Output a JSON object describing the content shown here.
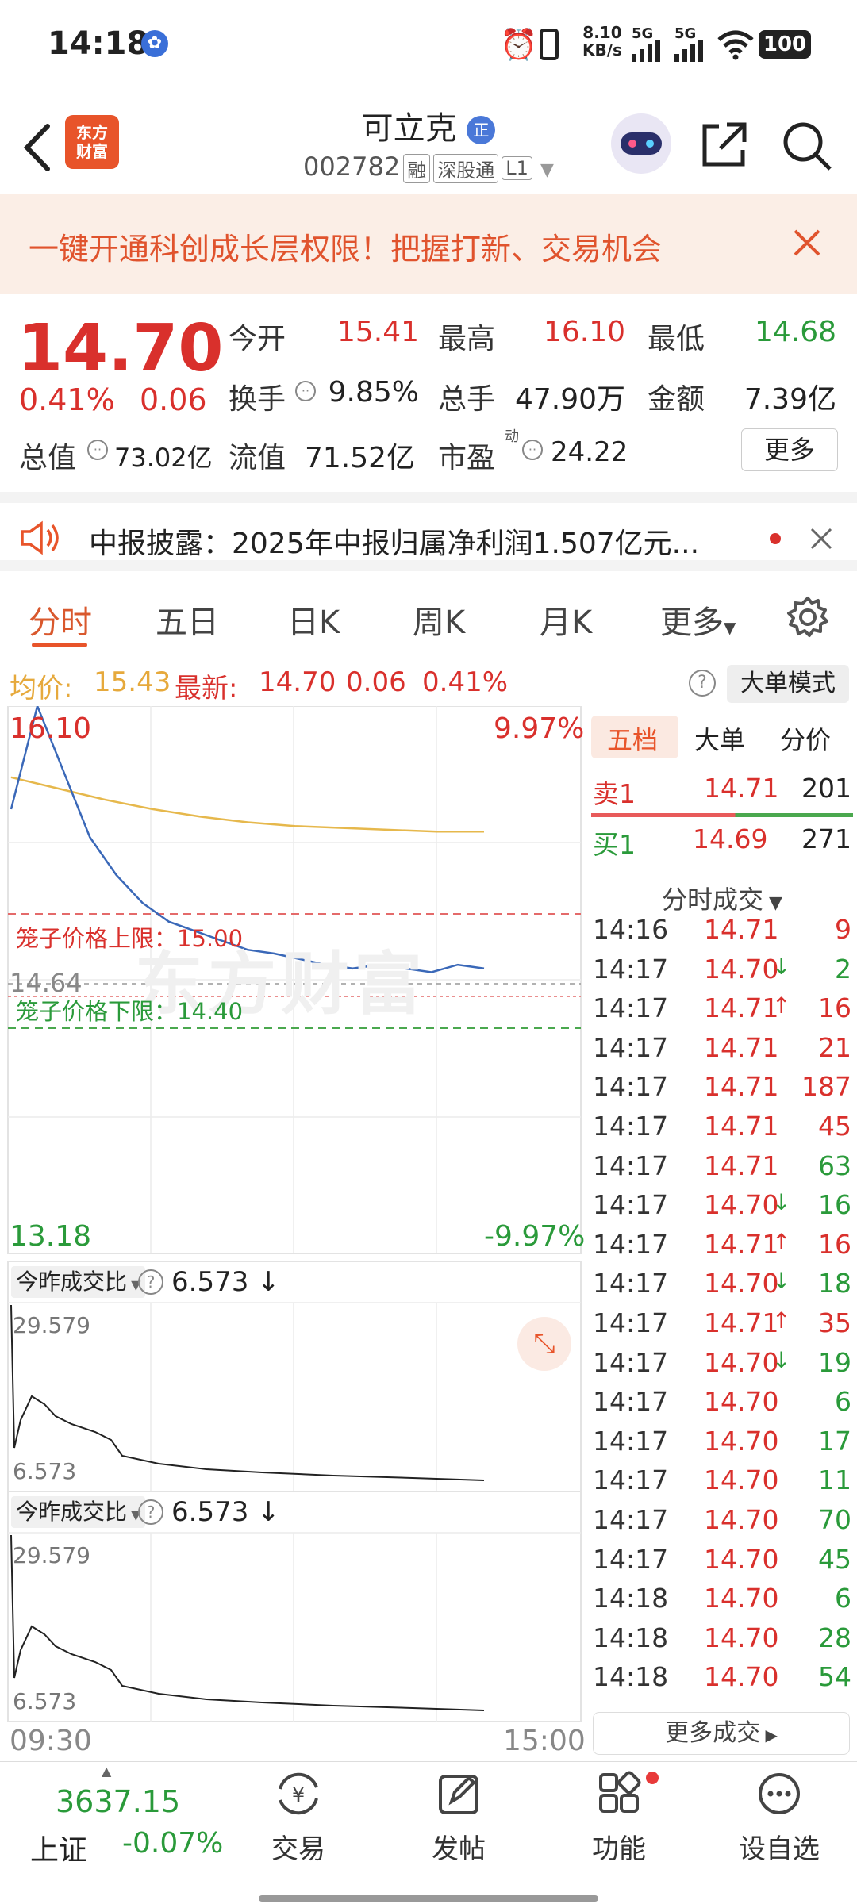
{
  "status_bar": {
    "time": "14:18",
    "net_speed_top": "8.10",
    "net_speed_unit": "KB/s",
    "signal1": "5G",
    "signal2": "5G",
    "battery": "100",
    "icons": [
      "baidu-icon",
      "alarm-icon",
      "vibrate-icon",
      "signal-icon",
      "wifi-icon",
      "battery-icon"
    ]
  },
  "header": {
    "logo_line1": "东方",
    "logo_line2": "财富",
    "stock_name": "可立克",
    "badge": "正",
    "stock_code": "002782",
    "tags": [
      "融",
      "深股通",
      "L1"
    ]
  },
  "banner": {
    "text": "一键开通科创成长层权限！把握打新、交易机会"
  },
  "quote": {
    "price": "14.70",
    "change_pct": "0.41%",
    "change": "0.06",
    "open_label": "今开",
    "open": "15.41",
    "high_label": "最高",
    "high": "16.10",
    "low_label": "最低",
    "low": "14.68",
    "turnover_label": "换手",
    "turnover": "9.85%",
    "volume_label": "总手",
    "volume": "47.90万",
    "amount_label": "金额",
    "amount": "7.39亿",
    "mktcap_label": "总值",
    "mktcap": "73.02亿",
    "float_label": "流值",
    "float_val": "71.52亿",
    "pe_label": "市盈",
    "pe_sup": "动",
    "pe": "24.22",
    "more": "更多"
  },
  "news": {
    "text": "中报披露：2025年中报归属净利润1.507亿元..."
  },
  "tabs": [
    "分时",
    "五日",
    "日K",
    "周K",
    "月K",
    "更多"
  ],
  "avgline": {
    "avg_label": "均价:",
    "avg": "15.43",
    "latest_label": "最新:",
    "latest": "14.70",
    "change": "0.06",
    "pct": "0.41%",
    "mode_button": "大单模式"
  },
  "chart": {
    "y_top": "16.10",
    "pct_top": "9.97%",
    "y_bottom": "13.18",
    "pct_bottom": "-9.97%",
    "cage_upper": "笼子价格上限：15.00",
    "cage_lower": "笼子价格下限：14.40",
    "cursor_price": "14.64",
    "time_start": "09:30",
    "time_end": "15:00",
    "watermark": "东方财富",
    "sub_label": "今昨成交比",
    "sub_value": "6.573",
    "sub_arrow": "↓",
    "sub_max": "29.579",
    "sub_min": "6.573"
  },
  "chart_data": {
    "type": "line",
    "ylim": [
      13.18,
      16.1
    ],
    "series": [
      {
        "name": "均价",
        "color": "#e6b84c",
        "values": [
          15.72,
          15.66,
          15.6,
          15.55,
          15.51,
          15.48,
          15.46,
          15.45,
          15.44,
          15.43,
          15.43
        ]
      },
      {
        "name": "最新",
        "color": "#3a68b8",
        "values": [
          15.55,
          16.1,
          15.75,
          15.4,
          15.2,
          15.05,
          14.95,
          14.9,
          14.85,
          14.8,
          14.78,
          14.75,
          14.72,
          14.7,
          14.72,
          14.7,
          14.68,
          14.72,
          14.7
        ]
      }
    ]
  },
  "book": {
    "tabs": [
      "五档",
      "大单",
      "分价"
    ],
    "sell1_label": "卖1",
    "sell1_price": "14.71",
    "sell1_vol": "201",
    "buy1_label": "买1",
    "buy1_price": "14.69",
    "buy1_vol": "271",
    "trades_title": "分时成交",
    "more_trades": "更多成交",
    "trades": [
      {
        "t": "14:16",
        "p": "14.71",
        "a": "",
        "v": "9",
        "c": "red"
      },
      {
        "t": "14:17",
        "p": "14.70",
        "a": "↓",
        "v": "2",
        "c": "green"
      },
      {
        "t": "14:17",
        "p": "14.71",
        "a": "↑",
        "v": "16",
        "c": "red"
      },
      {
        "t": "14:17",
        "p": "14.71",
        "a": "",
        "v": "21",
        "c": "red"
      },
      {
        "t": "14:17",
        "p": "14.71",
        "a": "",
        "v": "187",
        "c": "red"
      },
      {
        "t": "14:17",
        "p": "14.71",
        "a": "",
        "v": "45",
        "c": "red"
      },
      {
        "t": "14:17",
        "p": "14.71",
        "a": "",
        "v": "63",
        "c": "green"
      },
      {
        "t": "14:17",
        "p": "14.70",
        "a": "↓",
        "v": "16",
        "c": "green"
      },
      {
        "t": "14:17",
        "p": "14.71",
        "a": "↑",
        "v": "16",
        "c": "red"
      },
      {
        "t": "14:17",
        "p": "14.70",
        "a": "↓",
        "v": "18",
        "c": "green"
      },
      {
        "t": "14:17",
        "p": "14.71",
        "a": "↑",
        "v": "35",
        "c": "red"
      },
      {
        "t": "14:17",
        "p": "14.70",
        "a": "↓",
        "v": "19",
        "c": "green"
      },
      {
        "t": "14:17",
        "p": "14.70",
        "a": "",
        "v": "6",
        "c": "green"
      },
      {
        "t": "14:17",
        "p": "14.70",
        "a": "",
        "v": "17",
        "c": "green"
      },
      {
        "t": "14:17",
        "p": "14.70",
        "a": "",
        "v": "11",
        "c": "green"
      },
      {
        "t": "14:17",
        "p": "14.70",
        "a": "",
        "v": "70",
        "c": "green"
      },
      {
        "t": "14:17",
        "p": "14.70",
        "a": "",
        "v": "45",
        "c": "green"
      },
      {
        "t": "14:18",
        "p": "14.70",
        "a": "",
        "v": "6",
        "c": "green"
      },
      {
        "t": "14:18",
        "p": "14.70",
        "a": "",
        "v": "28",
        "c": "green"
      },
      {
        "t": "14:18",
        "p": "14.70",
        "a": "",
        "v": "54",
        "c": "green"
      }
    ]
  },
  "bottom": {
    "index_value": "3637.15",
    "index_name": "上证",
    "index_change": "-0.07%",
    "nav": [
      "交易",
      "发帖",
      "功能",
      "设自选"
    ]
  },
  "colors": {
    "red": "#d9302c",
    "green": "#2a9a3a",
    "accent": "#e8542a",
    "avg_line": "#e6b84c",
    "price_line": "#3a68b8"
  }
}
